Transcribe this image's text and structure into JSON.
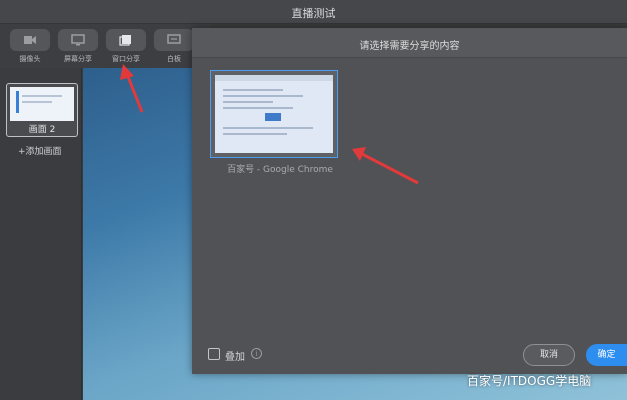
{
  "window": {
    "title": "直播测试"
  },
  "toolbar": {
    "items": [
      {
        "label": "摄像头",
        "icon": "camera-icon"
      },
      {
        "label": "屏幕分享",
        "icon": "screen-share-icon"
      },
      {
        "label": "窗口分享",
        "icon": "window-share-icon"
      },
      {
        "label": "白板",
        "icon": "whiteboard-icon"
      }
    ]
  },
  "scenes": {
    "items": [
      {
        "label": "画面 2"
      }
    ],
    "add_label": "+添加画面"
  },
  "dialog": {
    "title": "请选择需要分享的内容",
    "windows": [
      {
        "label": "百家号 - Google Chrome"
      }
    ],
    "overlay_label": "叠加",
    "cancel_label": "取消",
    "ok_label": "确定"
  },
  "watermark": "百家号/ITDOGG学电脑",
  "colors": {
    "accent": "#2d8ef0",
    "annotation_arrow": "#e23a3a"
  }
}
